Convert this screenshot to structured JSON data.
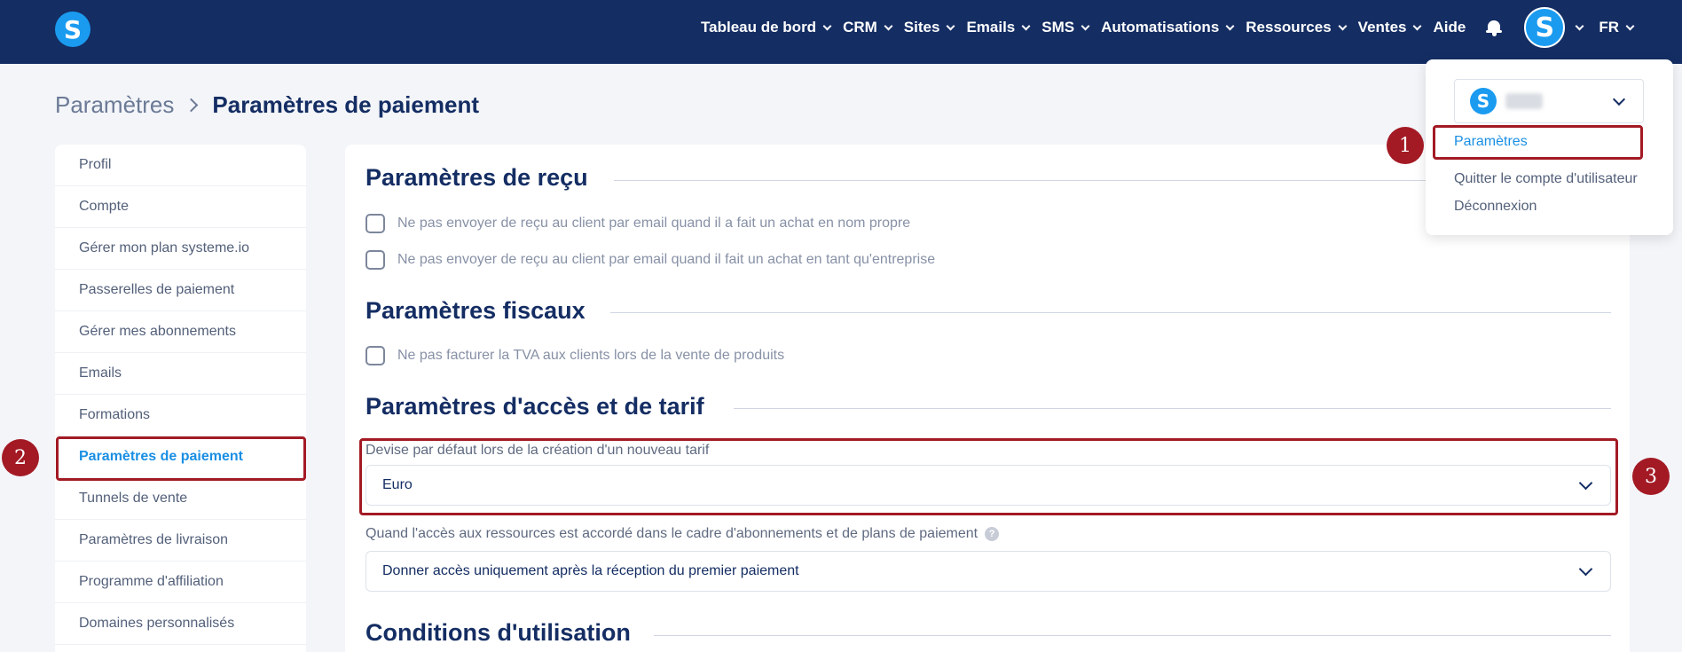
{
  "nav": {
    "items": [
      {
        "label": "Tableau de bord",
        "has_chevron": true
      },
      {
        "label": "CRM",
        "has_chevron": true
      },
      {
        "label": "Sites",
        "has_chevron": true
      },
      {
        "label": "Emails",
        "has_chevron": true
      },
      {
        "label": "SMS",
        "has_chevron": true
      },
      {
        "label": "Automatisations",
        "has_chevron": true
      },
      {
        "label": "Ressources",
        "has_chevron": true
      },
      {
        "label": "Ventes",
        "has_chevron": true
      },
      {
        "label": "Aide",
        "has_chevron": false
      }
    ],
    "avatar_letter": "S",
    "logo_letter": "S",
    "language": "FR"
  },
  "breadcrumb": {
    "root": "Paramètres",
    "current": "Paramètres de paiement"
  },
  "sidebar": {
    "items": [
      {
        "label": "Profil"
      },
      {
        "label": "Compte"
      },
      {
        "label": "Gérer mon plan systeme.io"
      },
      {
        "label": "Passerelles de paiement"
      },
      {
        "label": "Gérer mes abonnements"
      },
      {
        "label": "Emails"
      },
      {
        "label": "Formations"
      },
      {
        "label": "Paramètres de paiement",
        "active": true
      },
      {
        "label": "Tunnels de vente"
      },
      {
        "label": "Paramètres de livraison"
      },
      {
        "label": "Programme d'affiliation"
      },
      {
        "label": "Domaines personnalisés"
      }
    ]
  },
  "main": {
    "receipt": {
      "title": "Paramètres de reçu",
      "options": [
        "Ne pas envoyer de reçu au client par email quand il a fait un achat en nom propre",
        "Ne pas envoyer de reçu au client par email quand il fait un achat en tant qu'entreprise"
      ]
    },
    "tax": {
      "title": "Paramètres fiscaux",
      "options": [
        "Ne pas facturer la TVA aux clients lors de la vente de produits"
      ]
    },
    "access": {
      "title": "Paramètres d'accès et de tarif",
      "currency_label": "Devise par défaut lors de la création d'un nouveau tarif",
      "currency_value": "Euro",
      "access_label": "Quand l'accès aux ressources est accordé dans le cadre d'abonnements et de plans de paiement",
      "access_value": "Donner accès uniquement après la réception du premier paiement"
    },
    "terms": {
      "title": "Conditions d'utilisation"
    }
  },
  "dropdown": {
    "settings": "Paramètres",
    "quit": "Quitter le compte d'utilisateur",
    "logout": "Déconnexion"
  },
  "annotations": {
    "markers": [
      "1",
      "2",
      "3"
    ]
  },
  "colors": {
    "nav_bg": "#142d63",
    "accent_blue": "#1a8fe3",
    "brand_blue": "#1a9bf0",
    "annotation_red": "#a31a24"
  }
}
